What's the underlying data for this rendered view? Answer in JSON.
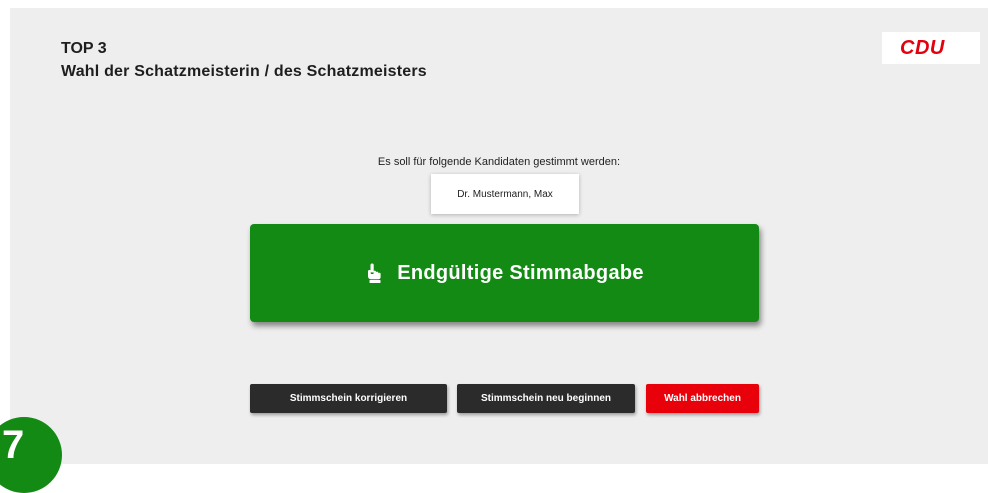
{
  "topic": {
    "number": "TOP 3",
    "title": "Wahl der Schatzmeisterin / des Schatzmeisters"
  },
  "logo": {
    "text": "CDU"
  },
  "ballot": {
    "instruction": "Es soll für folgende Kandidaten gestimmt werden:",
    "candidates": [
      "Dr. Mustermann, Max"
    ]
  },
  "main_action": {
    "label": "Endgültige Stimmabgabe",
    "icon": "pointing-hand-icon"
  },
  "actions": {
    "correct": "Stimmschein korrigieren",
    "restart": "Stimmschein neu beginnen",
    "cancel": "Wahl abbrechen"
  },
  "step_badge": {
    "number": "7"
  },
  "colors": {
    "primary_green": "#138a14",
    "danger_red": "#e8000b",
    "dark_button": "#2b2b2b",
    "background": "#eeeeee"
  }
}
